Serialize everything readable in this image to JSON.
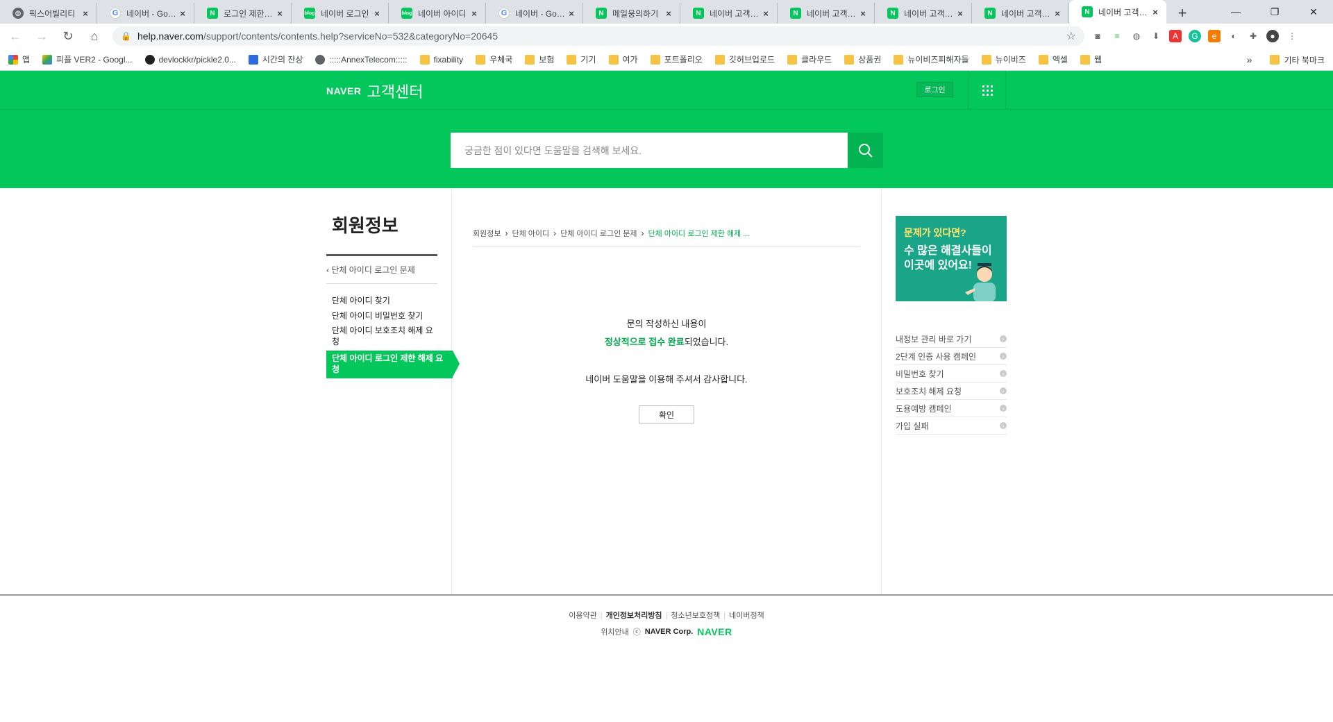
{
  "browser": {
    "tabs": [
      {
        "title": "픽스어빌리티",
        "icon": "globe"
      },
      {
        "title": "네이버 - Google",
        "icon": "google"
      },
      {
        "title": "로그인 제한 해제",
        "icon": "naver"
      },
      {
        "title": "네이버 로그인",
        "icon": "blog"
      },
      {
        "title": "네이버 아이디",
        "icon": "blog"
      },
      {
        "title": "네이버 - Google",
        "icon": "google"
      },
      {
        "title": "메일웅의하기",
        "icon": "naver"
      },
      {
        "title": "네이버 고객센터",
        "icon": "naver"
      },
      {
        "title": "네이버 고객센터",
        "icon": "naver"
      },
      {
        "title": "네이버 고객센터",
        "icon": "naver"
      },
      {
        "title": "네이버 고객센터",
        "icon": "naver"
      },
      {
        "title": "네이버 고객센터",
        "icon": "naver",
        "active": true
      }
    ],
    "new_tab": "+",
    "url_host": "help.naver.com",
    "url_path": "/support/contents/contents.help?serviceNo=532&categoryNo=20645",
    "bookmarks": [
      {
        "label": "앱",
        "type": "apps"
      },
      {
        "label": "피플 VER2 - Googl...",
        "type": "drive"
      },
      {
        "label": "devlockkr/pickle2.0...",
        "type": "github"
      },
      {
        "label": "시간의 잔상",
        "type": "site"
      },
      {
        "label": ":::::AnnexTelecom:::::",
        "type": "globe"
      },
      {
        "label": "fixability",
        "type": "folder"
      },
      {
        "label": "우체국",
        "type": "folder"
      },
      {
        "label": "보험",
        "type": "folder"
      },
      {
        "label": "기기",
        "type": "folder"
      },
      {
        "label": "여가",
        "type": "folder"
      },
      {
        "label": "포트폴리오",
        "type": "folder"
      },
      {
        "label": "깃허브업로드",
        "type": "folder"
      },
      {
        "label": "클라우드",
        "type": "folder"
      },
      {
        "label": "상품권",
        "type": "folder"
      },
      {
        "label": "뉴이비즈피해자들",
        "type": "folder"
      },
      {
        "label": "뉴이비즈",
        "type": "folder"
      },
      {
        "label": "엑셀",
        "type": "folder"
      },
      {
        "label": "웹",
        "type": "folder"
      }
    ],
    "bookmarks_more": "»",
    "other_bookmarks": "기타 북마크"
  },
  "header": {
    "brand": "NAVER",
    "service": "고객센터",
    "login": "로그인"
  },
  "search": {
    "placeholder": "궁금한 점이 있다면 도움말을 검색해 보세요."
  },
  "lnb": {
    "title": "회원정보",
    "back": "단체 아이디 로그인 문제",
    "items": [
      "단체 아이디 찾기",
      "단체 아이디 비밀번호 찾기",
      "단체 아이디 보호조치 해제 요청",
      "단체 아이디 로그인 제한 해제 요청"
    ],
    "active_index": 3
  },
  "breadcrumb": [
    "회원정보",
    "단체 아이디",
    "단체 아이디 로그인 문제",
    "단체 아이디 로그인 제한 해제 ..."
  ],
  "message": {
    "line1": "문의 작성하신 내용이",
    "line2_green": "정상적으로 접수 완료",
    "line2_rest": "되었습니다.",
    "line3": "네이버 도움말을 이용해 주셔서 감사합니다.",
    "confirm": "확인"
  },
  "aside": {
    "banner_title": "문제가 있다면?",
    "banner_text1": "수 많은 해결사들이",
    "banner_text2": "이곳에 있어요!",
    "links": [
      "내정보 관리 바로 가기",
      "2단계 인증 사용 캠페인",
      "비밀번호 찾기",
      "보호조치 해제 요청",
      "도용예방 캠페인",
      "가입 실패"
    ]
  },
  "footer": {
    "links": [
      "이용약관",
      "개인정보처리방침",
      "청소년보호정책",
      "네이버정책"
    ],
    "location": "위치안내",
    "copyright": "ⓒ",
    "corp": "NAVER Corp.",
    "logo": "NAVER"
  },
  "colors": {
    "naver_green": "#03c75a",
    "accent_text": "#03a94e"
  }
}
